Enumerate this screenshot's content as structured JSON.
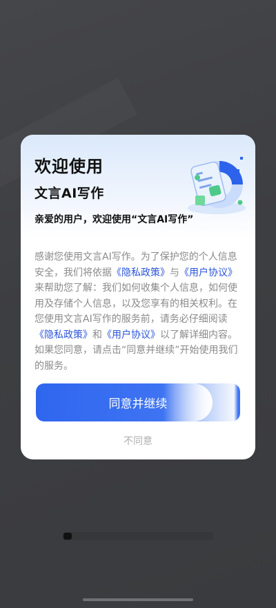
{
  "dialog": {
    "title": "欢迎使用",
    "subtitle": "文言AI写作",
    "greeting": "亲爱的用户，欢迎使用“文言AI写作”",
    "body": {
      "p1": "感谢您使用文言AI写作。为了保护您的个人信息安全，我们将依据",
      "link_privacy": "《隐私政策》",
      "p2": "与",
      "link_agreement": "《用户协议》",
      "p3": "来帮助您了解：我们如何收集个人信息，如何使用及存储个人信息，以及您享有的相关权利。在您使用文言AI写作的服务前，请务必仔细阅读",
      "link_privacy_2": "《隐私政策》",
      "p4": "和",
      "link_agreement_2": "《用户协议》",
      "p5": "以了解详细内容。如果您同意，请点击“同意并继续”开始使用我们的服务。"
    },
    "agree_label": "同意并继续",
    "disagree_label": "不同意"
  },
  "colors": {
    "primary": "#2f66ef",
    "link": "#2a55d8",
    "body_text": "#8a8a8a",
    "backdrop": "#3e3f42"
  }
}
